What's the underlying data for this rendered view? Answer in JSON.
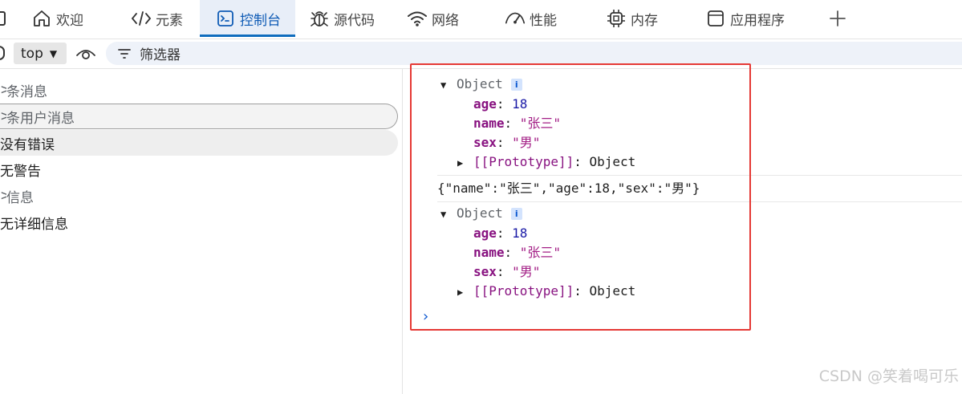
{
  "tabs": [
    {
      "label": "欢迎",
      "icon": "home-icon"
    },
    {
      "label": "元素",
      "icon": "code-icon"
    },
    {
      "label": "控制台",
      "icon": "console-icon",
      "active": true
    },
    {
      "label": "源代码",
      "icon": "bug-icon"
    },
    {
      "label": "网络",
      "icon": "wifi-icon"
    },
    {
      "label": "性能",
      "icon": "gauge-icon"
    },
    {
      "label": "内存",
      "icon": "chip-icon"
    },
    {
      "label": "应用程序",
      "icon": "window-icon"
    }
  ],
  "add_tab_icon": "plus-icon",
  "toolbar": {
    "context": "top",
    "filter_placeholder": "筛选器",
    "eye_icon": "eye-icon",
    "filter_icon": "filter-icon"
  },
  "sidebar": {
    "items": [
      {
        "label": "条消息",
        "muted": true
      },
      {
        "label": "条用户消息",
        "muted": true
      },
      {
        "label": "没有错误",
        "muted": false
      },
      {
        "label": "无警告",
        "muted": false
      },
      {
        "label": "信息",
        "muted": true
      },
      {
        "label": "无详细信息",
        "muted": false
      }
    ]
  },
  "console": {
    "objects": [
      {
        "head": "Object",
        "badge": "i",
        "props": [
          {
            "key": "age",
            "value": "18",
            "type": "num"
          },
          {
            "key": "name",
            "value": "\"张三\"",
            "type": "str"
          },
          {
            "key": "sex",
            "value": "\"男\"",
            "type": "str"
          }
        ],
        "proto": "[[Prototype]]",
        "proto_value": "Object"
      },
      {
        "head": "Object",
        "badge": "i",
        "props": [
          {
            "key": "age",
            "value": "18",
            "type": "num"
          },
          {
            "key": "name",
            "value": "\"张三\"",
            "type": "str"
          },
          {
            "key": "sex",
            "value": "\"男\"",
            "type": "str"
          }
        ],
        "proto": "[[Prototype]]",
        "proto_value": "Object"
      }
    ],
    "json_line": "{\"name\":\"张三\",\"age\":18,\"sex\":\"男\"}",
    "prompt": "›"
  },
  "colors": {
    "accent": "#0f6cbd",
    "highlight_box": "#e53935",
    "key": "#881280",
    "number": "#1a1aa6",
    "string": "#a31f86"
  },
  "watermark": "CSDN @笑着喝可乐"
}
